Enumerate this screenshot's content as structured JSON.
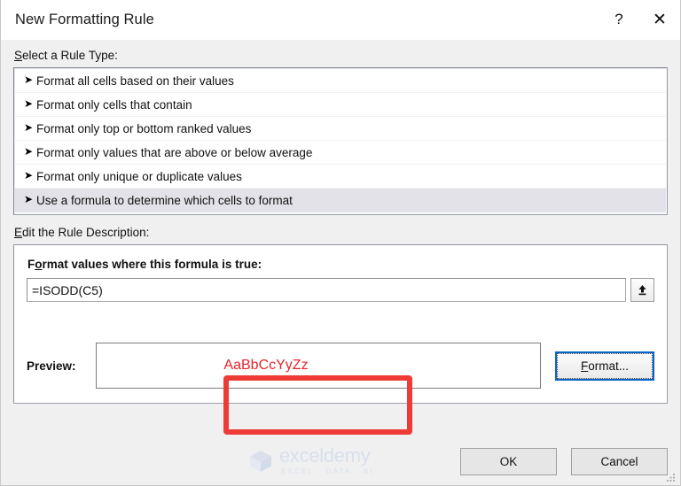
{
  "window": {
    "title": "New Formatting Rule",
    "help_label": "?",
    "close_label": "✕"
  },
  "rule_type": {
    "label": "Select a Rule Type:",
    "accelerator": "S",
    "items": [
      {
        "label": "Format all cells based on their values",
        "selected": false
      },
      {
        "label": "Format only cells that contain",
        "selected": false
      },
      {
        "label": "Format only top or bottom ranked values",
        "selected": false
      },
      {
        "label": "Format only values that are above or below average",
        "selected": false
      },
      {
        "label": "Format only unique or duplicate values",
        "selected": false
      },
      {
        "label": "Use a formula to determine which cells to format",
        "selected": true
      }
    ],
    "bullet_glyph": "➤"
  },
  "rule_description": {
    "label": "Edit the Rule Description:",
    "accelerator": "E",
    "formula_label": "Format values where this formula is true:",
    "formula_label_accelerator": "o",
    "formula_value": "=ISODD(C5)",
    "formula_placeholder": "",
    "range_select_icon": "collapse-dialog-up-arrow-icon",
    "preview_label": "Preview:",
    "preview_sample_text": "AaBbCcYyZz",
    "preview_sample_color": "#e8232a",
    "format_button_label": "Format...",
    "format_button_accelerator": "F"
  },
  "footer": {
    "ok_label": "OK",
    "cancel_label": "Cancel"
  },
  "watermark": {
    "name": "exceldemy",
    "tagline": "EXCEL · DATA · BI"
  },
  "annotation": {
    "shape": "rectangle-highlight",
    "color": "#ef3b36"
  },
  "colors": {
    "dialog_background": "#f0f0f0",
    "titlebar_background": "#ffffff",
    "list_selected_background": "#e2e2e8",
    "focus_border": "#0a64c8",
    "annotation_red": "#ef3b36",
    "preview_red": "#e8232a"
  }
}
